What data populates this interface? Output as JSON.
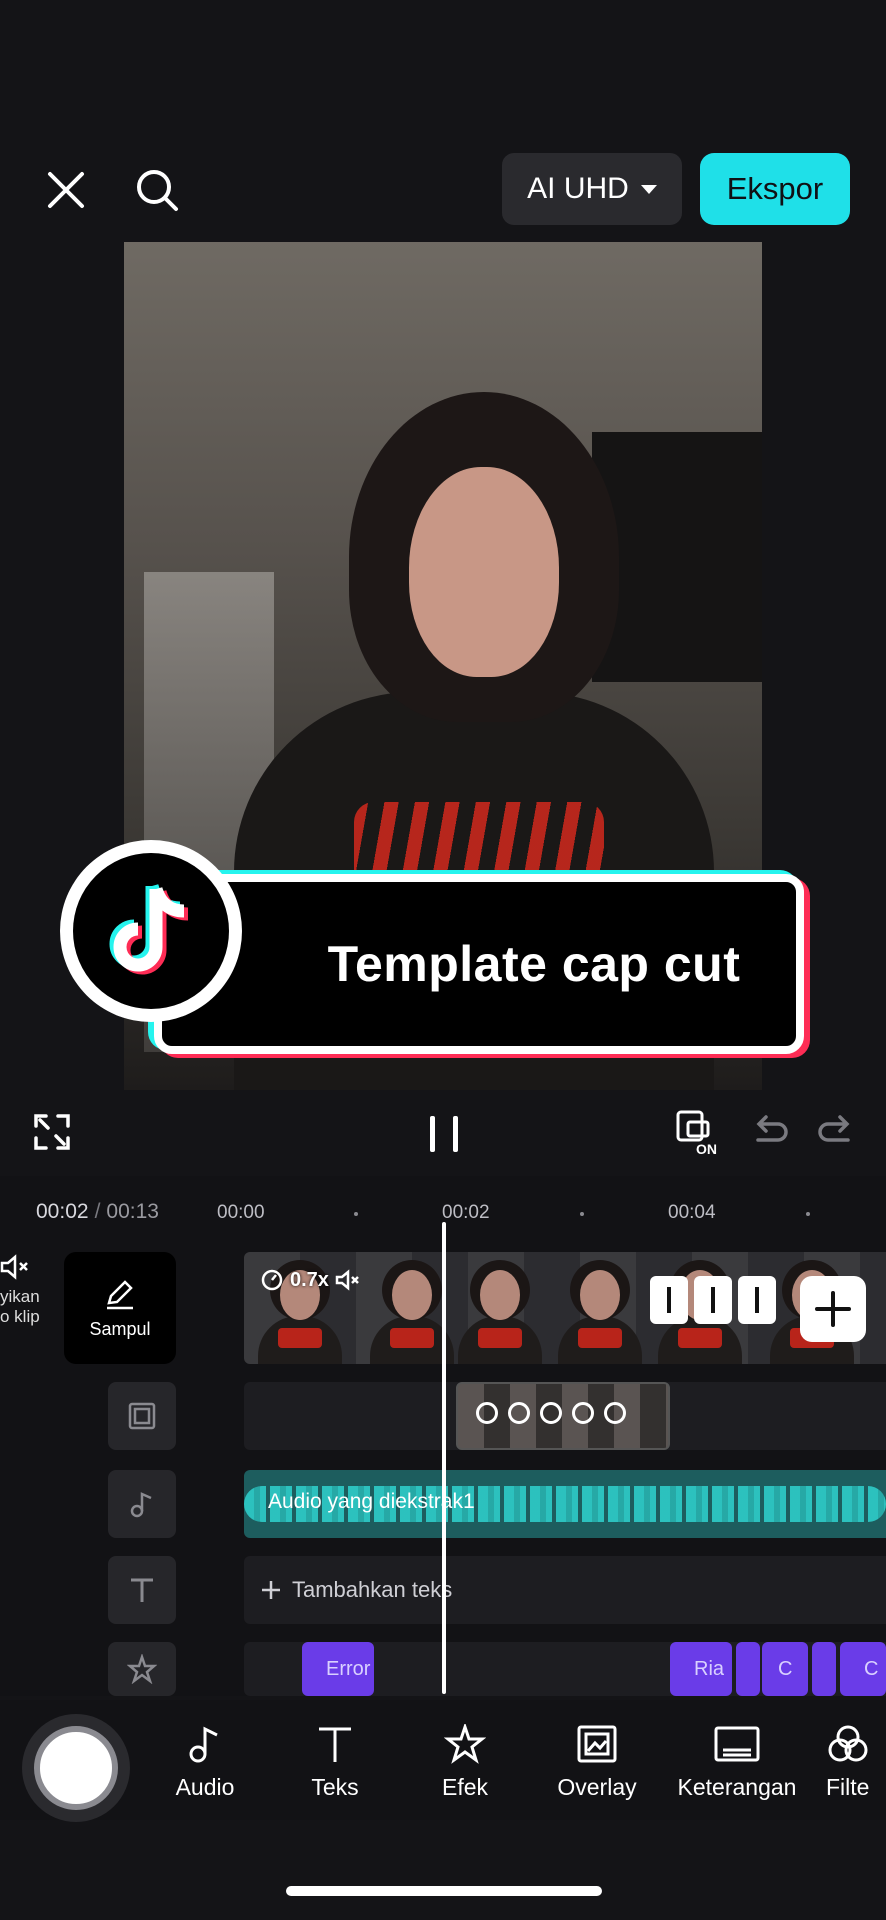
{
  "header": {
    "quality_label": "AI UHD",
    "export_label": "Ekspor"
  },
  "banner": {
    "text": "Template cap cut"
  },
  "timeline": {
    "current_time": "00:02",
    "separator": "/",
    "total_time": "00:13",
    "ticks": [
      "00:00",
      "00:02",
      "00:04"
    ],
    "mute_label_line1": "yikan",
    "mute_label_line2": "o klip",
    "cover_label": "Sampul",
    "speed_label": "0.7x",
    "audio_label": "Audio yang diekstrak1",
    "add_text_label": "Tambahkan teks",
    "fx_clips": [
      "Error",
      "Ria",
      "C",
      "C"
    ]
  },
  "toolbar": {
    "items": [
      {
        "label": "Audio",
        "icon": "music-note-icon"
      },
      {
        "label": "Teks",
        "icon": "text-icon"
      },
      {
        "label": "Efek",
        "icon": "star-effect-icon"
      },
      {
        "label": "Overlay",
        "icon": "overlay-image-icon"
      },
      {
        "label": "Keterangan",
        "icon": "captions-icon"
      },
      {
        "label": "Filte",
        "icon": "filter-icon"
      }
    ]
  },
  "colors": {
    "accent": "#1fe0e8",
    "tiktok_cyan": "#25f4ee",
    "tiktok_red": "#fe2c55",
    "fx_purple": "#6a3ce8",
    "audio_teal": "#1d5d5e"
  }
}
